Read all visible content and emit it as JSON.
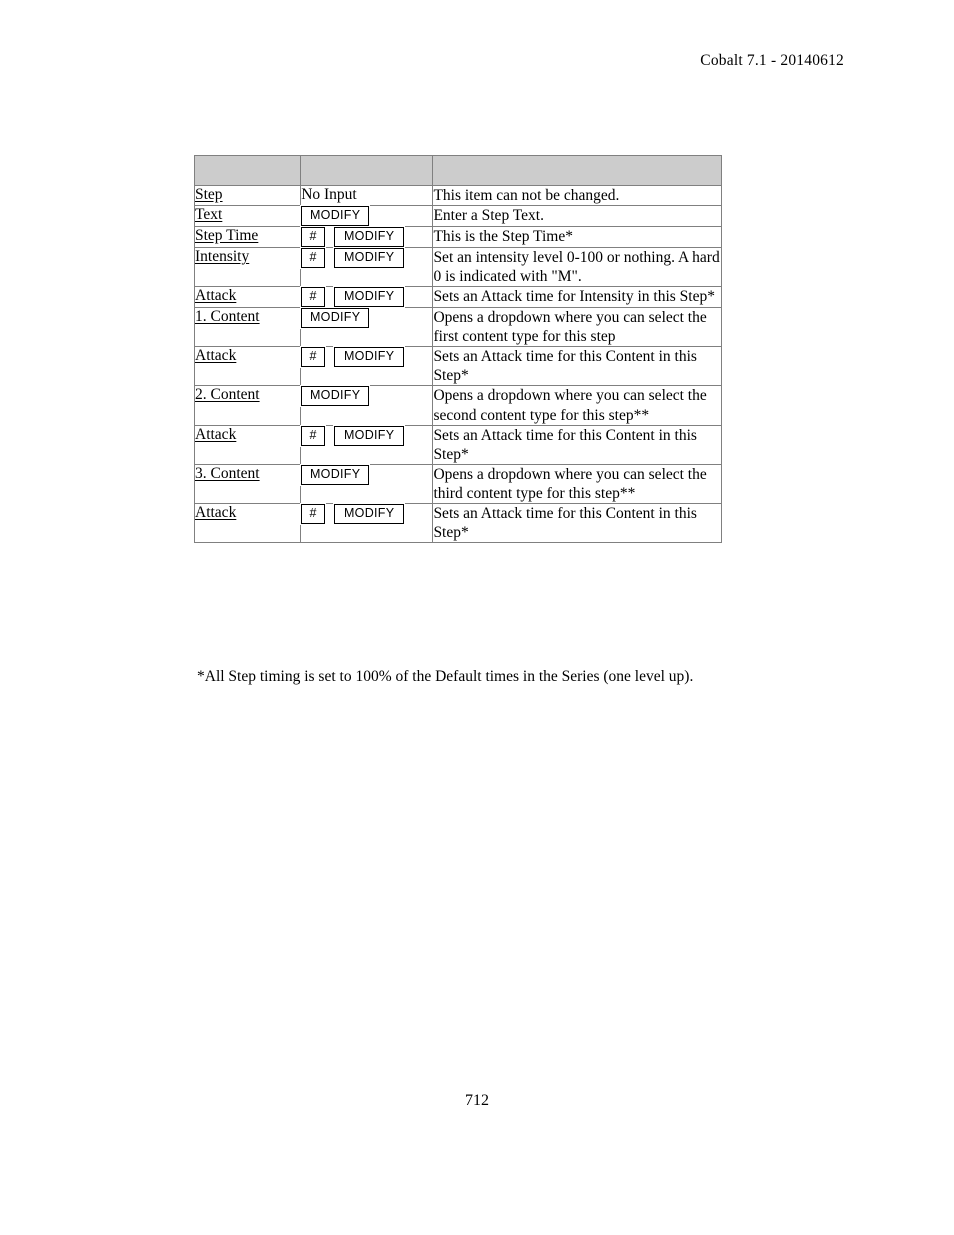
{
  "header": {
    "text": "Cobalt 7.1 - 20140612"
  },
  "table": {
    "headers": [
      "",
      "",
      ""
    ],
    "rows": [
      {
        "label": "Step",
        "input": {
          "hash": false,
          "modify": false,
          "text": "No Input"
        },
        "description": "This item can not be changed."
      },
      {
        "label": "Text",
        "input": {
          "hash": false,
          "modify": true,
          "modify_label": "MODIFY"
        },
        "description": "Enter a Step Text."
      },
      {
        "label": "Step Time",
        "input": {
          "hash": true,
          "hash_label": "#",
          "modify": true,
          "modify_label": "MODIFY"
        },
        "description": "This is the Step Time*"
      },
      {
        "label": "Intensity",
        "input": {
          "hash": true,
          "hash_label": "#",
          "modify": true,
          "modify_label": "MODIFY"
        },
        "description": "Set an intensity level 0-100 or nothing. A hard 0 is indicated with \"M\"."
      },
      {
        "label": "Attack",
        "input": {
          "hash": true,
          "hash_label": "#",
          "modify": true,
          "modify_label": "MODIFY"
        },
        "description": "Sets an Attack time for Intensity in this Step*"
      },
      {
        "label": "1. Content",
        "input": {
          "hash": false,
          "modify": true,
          "modify_label": "MODIFY"
        },
        "description": "Opens a dropdown where you can select the first content type for this step"
      },
      {
        "label": "Attack",
        "input": {
          "hash": true,
          "hash_label": "#",
          "modify": true,
          "modify_label": "MODIFY"
        },
        "description": "Sets an Attack time for this Content in this Step*"
      },
      {
        "label": "2. Content",
        "input": {
          "hash": false,
          "modify": true,
          "modify_label": "MODIFY"
        },
        "description": "Opens a dropdown where you can select the second content type for this step**"
      },
      {
        "label": "Attack",
        "input": {
          "hash": true,
          "hash_label": "#",
          "modify": true,
          "modify_label": "MODIFY"
        },
        "description": "Sets an Attack time for this Content in this Step*"
      },
      {
        "label": "3. Content",
        "input": {
          "hash": false,
          "modify": true,
          "modify_label": "MODIFY"
        },
        "description": "Opens a dropdown where you can select the third content type for this step**"
      },
      {
        "label": "Attack",
        "input": {
          "hash": true,
          "hash_label": "#",
          "modify": true,
          "modify_label": "MODIFY"
        },
        "description": "Sets an Attack time for this Content in this Step*"
      }
    ]
  },
  "footnote": "*All Step timing is set to 100% of the Default times in the Series (one level up).",
  "page_number": "712",
  "colors": {
    "header_row_fill": "#cccccc",
    "table_border": "#808080",
    "text": "#000000",
    "page_background": "#ffffff"
  }
}
